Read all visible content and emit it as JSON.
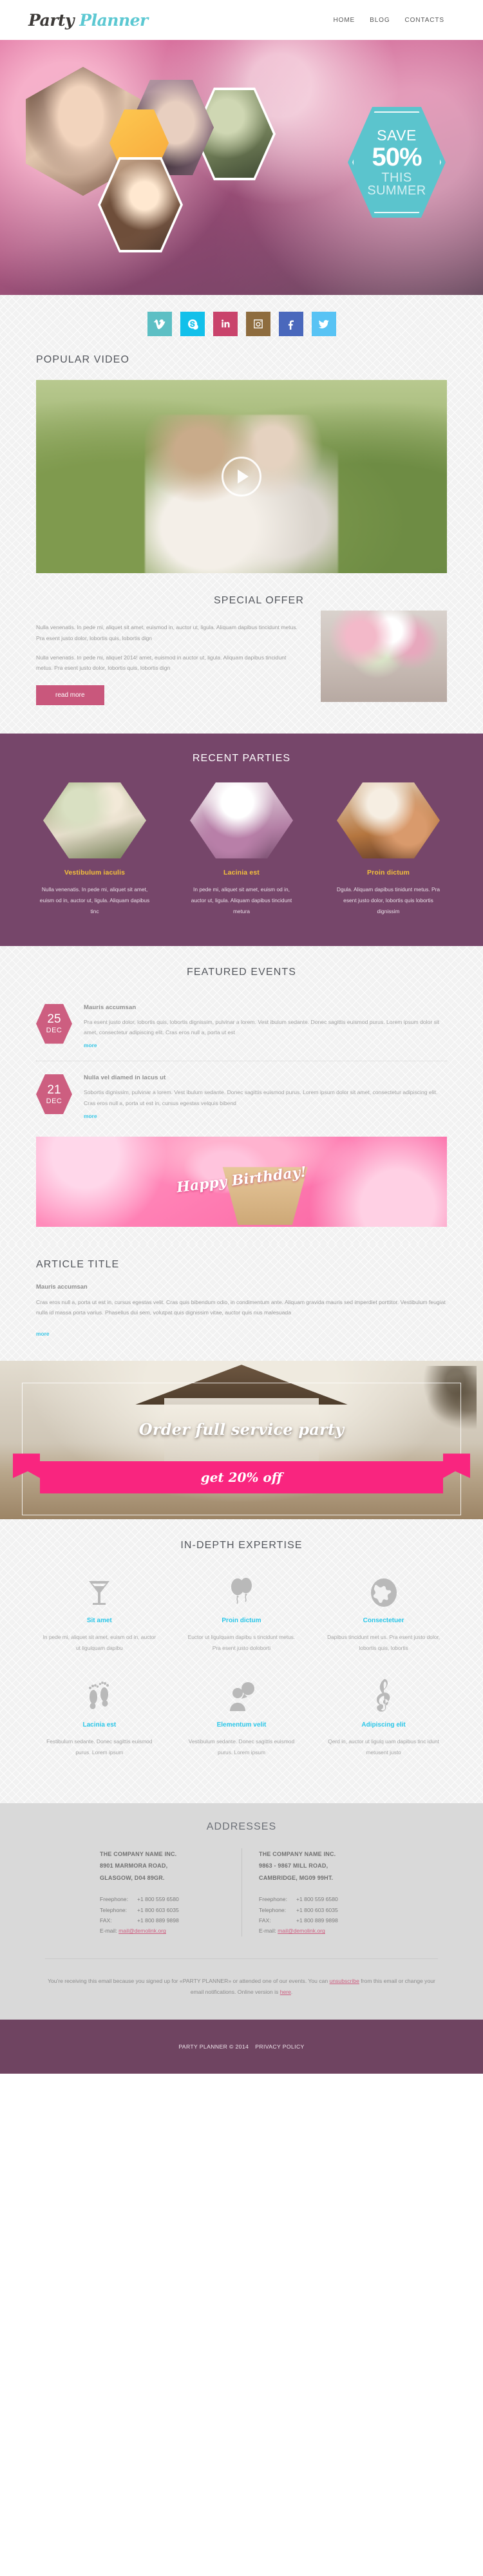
{
  "header": {
    "logo_part1": "Party",
    "logo_part2": "Planner",
    "nav": [
      {
        "label": "HOME"
      },
      {
        "label": "BLOG"
      },
      {
        "label": "CONTACTS"
      }
    ]
  },
  "hero": {
    "badge": {
      "line1": "SAVE",
      "line2": "50%",
      "line3": "THIS",
      "line4": "SUMMER",
      "color": "#5bc4cd"
    }
  },
  "social": [
    {
      "name": "vimeo",
      "label": "Vimeo",
      "color": "#5dbfc4"
    },
    {
      "name": "skype",
      "label": "Skype",
      "color": "#12c0ea"
    },
    {
      "name": "linkedin",
      "label": "LinkedIn",
      "color": "#c9436b"
    },
    {
      "name": "instagram",
      "label": "Instagram",
      "color": "#8e6c3e"
    },
    {
      "name": "facebook",
      "label": "Facebook",
      "color": "#4a68bc"
    },
    {
      "name": "twitter",
      "label": "Twitter",
      "color": "#58c3f4"
    }
  ],
  "video": {
    "title": "POPULAR VIDEO",
    "play_label": "play-button"
  },
  "offer": {
    "title": "SPECIAL OFFER",
    "paragraph1": "Nulla venenatis. In pede mi, aliquet sit amet, euismod in, auctor ut, ligula. Aliquam dapibus tincidunt metus. Pra esent justo dolor, lobortis quis, lobortis dign",
    "paragraph2": "Nulla venenatis. In pede mi, aliquet 2014! amet, euismod in auctor ut, ligula. Aliquam dapibus tincidunt metus. Pra esent justo dolor, lobortis quis, lobortis dign",
    "button": "read more"
  },
  "recent": {
    "title": "RECENT PARTIES",
    "cards": [
      {
        "heading": "Vestibulum iaculis",
        "text": "Nulla venenatis. In pede mi, aliquet sit amet, euism od in, auctor ut, ligula. Aliquam dapibus tinc"
      },
      {
        "heading": "Lacinia est",
        "text": "In pede mi, aliquet sit amet, euism od in, auctor ut, ligula. Aliquam dapibus tincidunt metura"
      },
      {
        "heading": "Proin dictum",
        "text": "Dgula. Aliquam dapibus tinidunt metus. Pra esent justo dolor, lobortis quis lobortis dignissim"
      }
    ]
  },
  "featured": {
    "title": "FEATURED EVENTS",
    "events": [
      {
        "day": "25",
        "month": "DEC",
        "heading": "Mauris accumsan",
        "text": "Pra esent justo dolor, lobortis quis, lobortis dignissim, pulvinar a lorem. Vest ibulum sedante. Donec sagittis euismod purus. Lorem ipsum dolor sit amet, consectetur adipiscing elit. Cras eros null a, porta ut est",
        "more": "more"
      },
      {
        "day": "21",
        "month": "DEC",
        "heading": "Nulla vel diamed in lacus ut",
        "text": "Sobortis dignissim, pulvinar a lorem. Vest ibulum sedante. Donec sagittis euismod purus. Lorem ipsum dolor sit amet, consectetur adipiscing elit. Cras eros null a, porta ut est in, cursus egestas velquis bibend",
        "more": "more"
      }
    ]
  },
  "cupcake": {
    "ribbon_text": "Happy Birthday!"
  },
  "article": {
    "title": "ARTICLE TITLE",
    "heading": "Mauris accumsan",
    "text": "Cras eros null a, porta ut est in, cursus egestas velit. Cras quis bibendum odio, in condimentum ante. Aliquam gravida mauris sed imperdiet porttitor. Vestibulum feugiat nulla id massa porta varius. Phasellus dui sem, volutpat quis dignissim vitae, auctor quis nus malesuada",
    "more": "more"
  },
  "order": {
    "headline": "Order full service party",
    "banner": "get 20% off",
    "banner_color": "#f9257f"
  },
  "expertise": {
    "title": "IN-DEPTH EXPERTISE",
    "items": [
      {
        "icon": "cocktail-glass-icon",
        "heading": "Sit amet",
        "text": "In pede mi, aliquet sit amet, euism od in, auctor ut ligulquam dapibu"
      },
      {
        "icon": "balloons-icon",
        "heading": "Proin dictum",
        "text": "Euctor ut ligulquam dapibu s tincidunt metus. Pra esent justo doloborti"
      },
      {
        "icon": "globe-icon",
        "heading": "Consectetuer",
        "text": "Dapibus tincidunt met us. Pra esent justo dolor, lobortis quis, lobortis"
      },
      {
        "icon": "footprints-icon",
        "heading": "Lacinia est",
        "text": "Festibulum sedante. Donec sagittis euismod purus. Lorem ipsum"
      },
      {
        "icon": "person-speech-icon",
        "heading": "Elementum velit",
        "text": "Vestibulum sedante. Donec sagittis euismod purus. Lorem ipsum"
      },
      {
        "icon": "treble-clef-icon",
        "heading": "Adipiscing elit",
        "text": "Qerd in, auctor ut ligulq uam dapibus tinc idunt metusent justo"
      }
    ]
  },
  "addresses": {
    "title": "ADDRESSES",
    "entries": [
      {
        "company": "THE COMPANY NAME INC.",
        "street": "8901 MARMORA ROAD,",
        "city": "GLASGOW, D04 89GR.",
        "freephone_label": "Freephone:",
        "freephone": "+1 800 559 6580",
        "telephone_label": "Telephone:",
        "telephone": "+1 800 603 6035",
        "fax_label": "FAX:",
        "fax": "+1 800 889 9898",
        "email_label": "E-mail:",
        "email": "mail@demolink.org"
      },
      {
        "company": "THE COMPANY NAME INC.",
        "street": "9863 - 9867 MILL ROAD,",
        "city": "CAMBRIDGE, MG09 99HT.",
        "freephone_label": "Freephone:",
        "freephone": "+1 800 559 6580",
        "telephone_label": "Telephone:",
        "telephone": "+1 800 603 6035",
        "fax_label": "FAX:",
        "fax": "+1 800 889 9898",
        "email_label": "E-mail:",
        "email": "mail@demolink.org"
      }
    ]
  },
  "legal": {
    "text_a": "You're receiving this email because you signed up for «PARTY PLANNER» or attended one of our events. You can ",
    "link_unsubscribe": "unsubscribe",
    "text_b": " from this email or change your email notifications. Online version is ",
    "link_here": "here",
    "text_c": "."
  },
  "copyright": {
    "text": "PARTY PLANNER © 2014",
    "privacy": "PRIVACY POLICY"
  }
}
